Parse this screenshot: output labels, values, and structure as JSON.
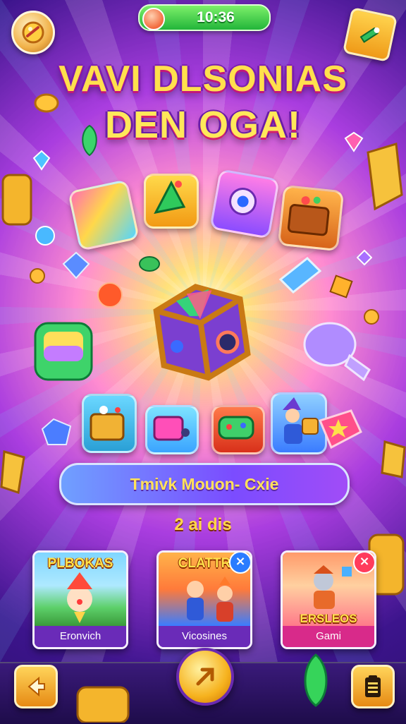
{
  "header": {
    "timer": "10:36"
  },
  "title": {
    "line1": "VAVI DLSONIAS",
    "line2": "DEN OGA!"
  },
  "mode_bar": {
    "label": "Tmivk Mouon- Cxie"
  },
  "counter": {
    "label": "2 ai dis"
  },
  "cards": [
    {
      "title": "PLBOKAS",
      "footer": "Eronvich"
    },
    {
      "title": "CLATTR",
      "footer": "Vicosines"
    },
    {
      "title": "ERSLEOS",
      "footer": "Gami"
    }
  ],
  "colors": {
    "accent": "#ffe04d",
    "timer_green": "#22b53a",
    "bar_purple": "#7b4cff",
    "close_blue": "#2a7cff",
    "close_red": "#ff3b5c"
  },
  "icons": {
    "top_left": "coin-badge-icon",
    "top_right": "gift-box-icon",
    "bottom_left": "back-arrow-icon",
    "bottom_center": "play-arrow-icon",
    "bottom_right": "clipboard-icon"
  }
}
